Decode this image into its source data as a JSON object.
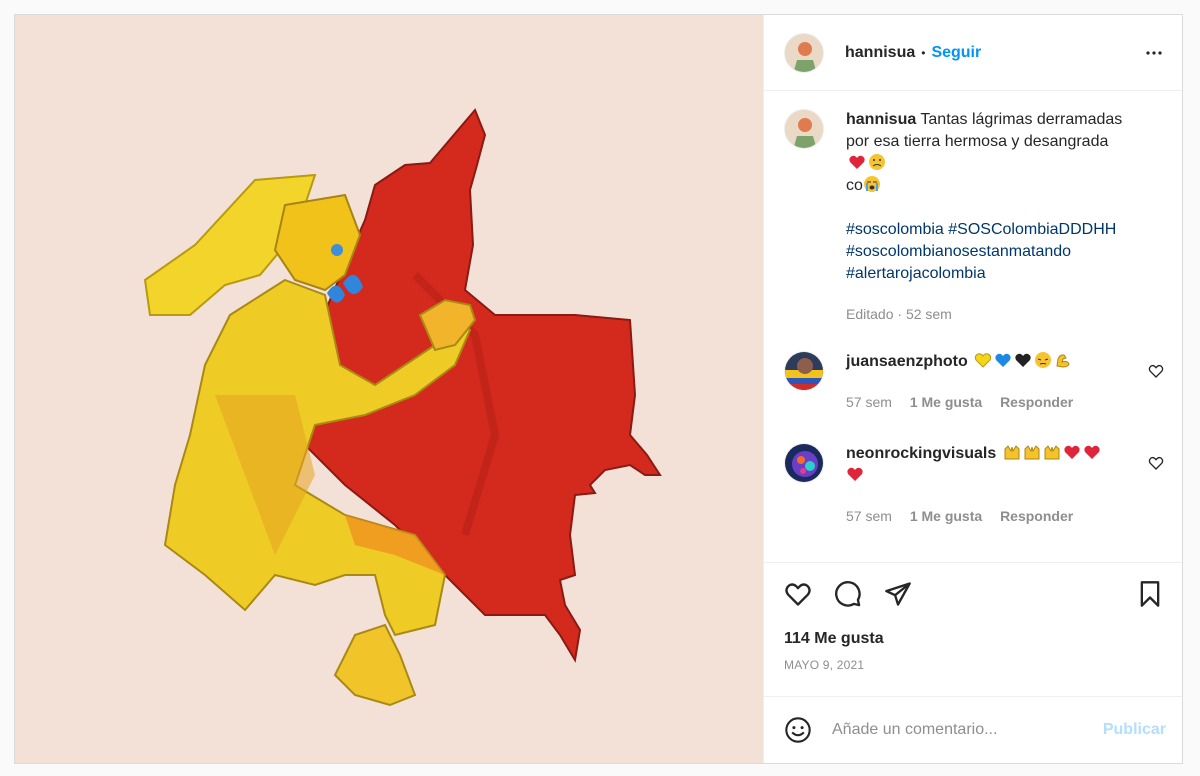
{
  "post": {
    "author": "hannisua",
    "follow_label": "Seguir",
    "dot": "•",
    "artwork_alt": "Painting of a crying yellow woman embracing a red map of Colombia"
  },
  "caption": {
    "username": "hannisua",
    "text_line1": "Tantas lágrimas derramadas",
    "text_line2": "por esa tierra hermosa y desangrada",
    "text_line3": "co",
    "hashtags": [
      "#soscolombia #SOSColombiaDDDHH",
      "#soscolombianosestanmatando",
      "#alertarojacolombia"
    ],
    "edited": "Editado",
    "time": "52 sem"
  },
  "comments": [
    {
      "username": "juansaenzphoto",
      "time": "57 sem",
      "likes": "1 Me gusta",
      "reply": "Responder"
    },
    {
      "username": "neonrockingvisuals",
      "time": "57 sem",
      "likes": "1 Me gusta",
      "reply": "Responder"
    }
  ],
  "likes_label": "114 Me gusta",
  "date_label": "MAYO 9, 2021",
  "comment_input": {
    "placeholder": "Añade un comentario...",
    "publish_label": "Publicar"
  },
  "icons": {
    "more": "more-horizontal-icon",
    "like": "heart-icon",
    "comment": "comment-bubble-icon",
    "share": "paper-plane-icon",
    "save": "bookmark-icon",
    "emoji": "smiley-icon"
  },
  "colors": {
    "accent": "#0095f6",
    "publish_disabled": "#b2dffc",
    "hashtag": "#00376b",
    "muted": "#8e8e8e"
  }
}
